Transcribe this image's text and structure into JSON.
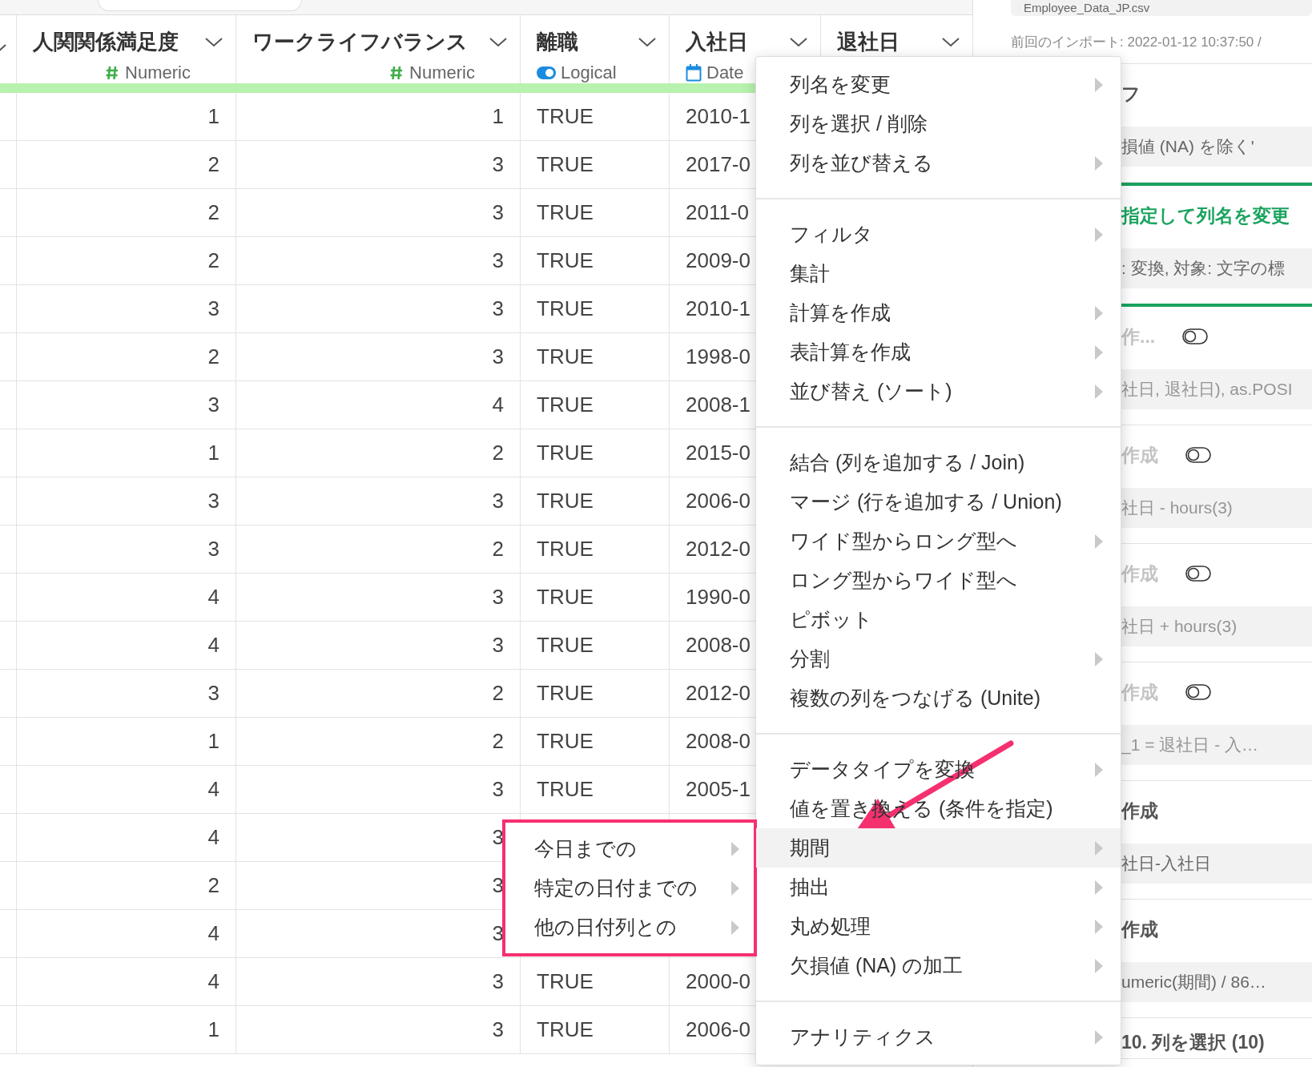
{
  "table": {
    "columns": [
      {
        "name": "人関関係満足度",
        "type": "Numeric",
        "kind": "numeric"
      },
      {
        "name": "ワークライフバランス",
        "type": "Numeric",
        "kind": "numeric"
      },
      {
        "name": "離職",
        "type": "Logical",
        "kind": "logical"
      },
      {
        "name": "入社日",
        "type": "Date",
        "kind": "date"
      },
      {
        "name": "退社日"
      }
    ],
    "rows": [
      [
        "1",
        "1",
        "TRUE",
        "2010-1"
      ],
      [
        "2",
        "3",
        "TRUE",
        "2017-0"
      ],
      [
        "2",
        "3",
        "TRUE",
        "2011-0"
      ],
      [
        "2",
        "3",
        "TRUE",
        "2009-0"
      ],
      [
        "3",
        "3",
        "TRUE",
        "2010-1"
      ],
      [
        "2",
        "3",
        "TRUE",
        "1998-0"
      ],
      [
        "3",
        "4",
        "TRUE",
        "2008-1"
      ],
      [
        "1",
        "2",
        "TRUE",
        "2015-0"
      ],
      [
        "3",
        "3",
        "TRUE",
        "2006-0"
      ],
      [
        "3",
        "2",
        "TRUE",
        "2012-0"
      ],
      [
        "4",
        "3",
        "TRUE",
        "1990-0"
      ],
      [
        "4",
        "3",
        "TRUE",
        "2008-0"
      ],
      [
        "3",
        "2",
        "TRUE",
        "2012-0"
      ],
      [
        "1",
        "2",
        "TRUE",
        "2008-0"
      ],
      [
        "4",
        "3",
        "TRUE",
        "2005-1"
      ],
      [
        "4",
        "3"
      ],
      [
        "2",
        "3"
      ],
      [
        "4",
        "3"
      ],
      [
        "4",
        "3",
        "TRUE",
        "2000-0"
      ],
      [
        "1",
        "3",
        "TRUE",
        "2006-0"
      ]
    ]
  },
  "context_menu": {
    "groups": [
      {
        "items": [
          {
            "label": "列名を変更",
            "submenu": true,
            "selected": false
          },
          {
            "label": "列を選択 / 削除",
            "submenu": false,
            "selected": false
          },
          {
            "label": "列を並び替える",
            "submenu": true,
            "selected": false
          }
        ]
      },
      {
        "items": [
          {
            "label": "フィルタ",
            "submenu": true,
            "selected": false
          },
          {
            "label": "集計",
            "submenu": false,
            "selected": false
          },
          {
            "label": "計算を作成",
            "submenu": true,
            "selected": false
          },
          {
            "label": "表計算を作成",
            "submenu": true,
            "selected": false
          },
          {
            "label": "並び替え (ソート)",
            "submenu": true,
            "selected": false
          }
        ]
      },
      {
        "items": [
          {
            "label": "結合 (列を追加する / Join)",
            "submenu": false,
            "selected": false
          },
          {
            "label": "マージ (行を追加する / Union)",
            "submenu": false,
            "selected": false
          },
          {
            "label": "ワイド型からロング型へ",
            "submenu": true,
            "selected": false
          },
          {
            "label": "ロング型からワイド型へ",
            "submenu": false,
            "selected": false
          },
          {
            "label": "ピボット",
            "submenu": false,
            "selected": false
          },
          {
            "label": "分割",
            "submenu": true,
            "selected": false
          },
          {
            "label": "複数の列をつなげる (Unite)",
            "submenu": false,
            "selected": false
          }
        ]
      },
      {
        "items": [
          {
            "label": "データタイプを変換",
            "submenu": true,
            "selected": false
          },
          {
            "label": "値を置き換える (条件を指定)",
            "submenu": false,
            "selected": false
          },
          {
            "label": "期間",
            "submenu": true,
            "selected": true
          },
          {
            "label": "抽出",
            "submenu": true,
            "selected": false
          },
          {
            "label": "丸め処理",
            "submenu": true,
            "selected": false
          },
          {
            "label": "欠損値 (NA) の加工",
            "submenu": true,
            "selected": false
          }
        ]
      },
      {
        "items": [
          {
            "label": "アナリティクス",
            "submenu": true,
            "selected": false
          }
        ]
      }
    ]
  },
  "submenu": {
    "items": [
      {
        "label": "今日までの",
        "submenu": true
      },
      {
        "label": "特定の日付までの",
        "submenu": true
      },
      {
        "label": "他の日付列との",
        "submenu": true
      }
    ]
  },
  "right_panel": {
    "source_file": "Employee_Data_JP.csv",
    "last_import": "前回のインポート: 2022-01-12 10:37:50 /",
    "steps": [
      {
        "title": "フ",
        "detail": "損値 (NA) を除く'",
        "selected": false,
        "disabled": false
      },
      {
        "title": "指定して列名を変更",
        "detail": ": 変換, 対象: 文字の標",
        "selected": true,
        "disabled": false
      },
      {
        "title": "作...",
        "detail": "社日, 退社日), as.POSI",
        "selected": false,
        "disabled": true
      },
      {
        "title": "作成",
        "detail": "社日 - hours(3)",
        "selected": false,
        "disabled": true
      },
      {
        "title": "作成",
        "detail": "社日 + hours(3)",
        "selected": false,
        "disabled": true
      },
      {
        "title": "作成",
        "detail": "_1 = 退社日 - 入…",
        "selected": false,
        "disabled": true
      },
      {
        "title": "作成",
        "detail": "社日-入社日",
        "selected": false,
        "disabled": false
      },
      {
        "title": "作成",
        "detail": "umeric(期間) / 86…",
        "selected": false,
        "disabled": false
      },
      {
        "title": "10. 列を選択 (10)",
        "selected": false,
        "disabled": false
      }
    ]
  }
}
